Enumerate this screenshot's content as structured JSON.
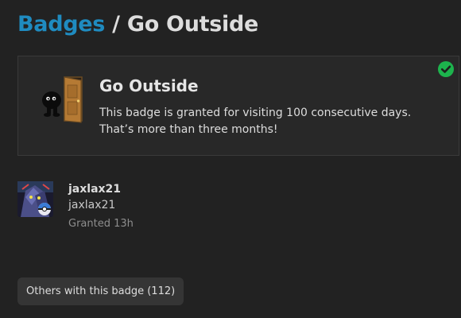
{
  "breadcrumb": {
    "parent_label": "Badges",
    "separator": "/",
    "current_label": "Go Outside"
  },
  "badge": {
    "name": "Go Outside",
    "description": "This badge is granted for visiting 100 consecutive days. That’s more than three months!",
    "icon": "door-with-character-icon",
    "granted_indicator_icon": "check-circle-icon"
  },
  "granted_user": {
    "username": "jaxlax21",
    "full_name": "jaxlax21",
    "granted_time": "Granted 13h",
    "avatar_icon": "user-avatar"
  },
  "others_button_label": "Others with this badge (112)",
  "colors": {
    "background": "#222222",
    "card_background": "#282828",
    "card_border": "#3a3a3a",
    "link": "#1f8bc0",
    "check_green": "#1db34d",
    "button_background": "#353535"
  }
}
